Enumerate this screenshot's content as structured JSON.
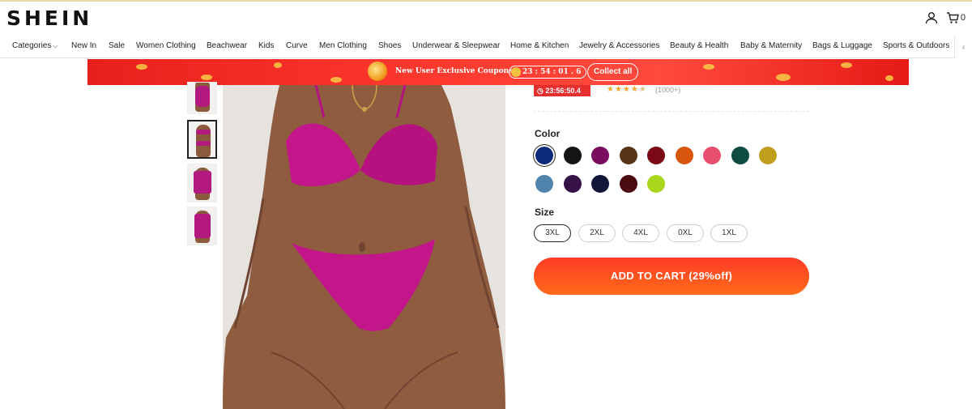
{
  "header": {
    "logo": "SHEIN",
    "cart_count": "0"
  },
  "nav": {
    "items": [
      "Categories",
      "New In",
      "Sale",
      "Women Clothing",
      "Beachwear",
      "Kids",
      "Curve",
      "Men Clothing",
      "Shoes",
      "Underwear & Sleepwear",
      "Home & Kitchen",
      "Jewelry & Accessories",
      "Beauty & Health",
      "Baby & Maternity",
      "Bags & Luggage",
      "Sports & Outdoors"
    ]
  },
  "banner": {
    "text": "New User Exclusive Coupons",
    "timer": "23 : 54 : 01 . 6",
    "button": "Collect all"
  },
  "product": {
    "flash_timer": "23:56:50.4",
    "rating_stars": 4.5,
    "review_count": "(1000+)",
    "color_label": "Color",
    "colors": [
      "#0b2a7a",
      "#151515",
      "#7a0d5e",
      "#5a3417",
      "#7a0b16",
      "#d9560f",
      "#e8506f",
      "#0d4b43",
      "#c2a01f",
      "#4e84ad",
      "#371246",
      "#12173a",
      "#4a0b10",
      "#a8d61c"
    ],
    "selected_color_index": 0,
    "size_label": "Size",
    "sizes": [
      "3XL",
      "2XL",
      "4XL",
      "0XL",
      "1XL"
    ],
    "selected_size_index": 0,
    "add_to_cart": "ADD TO CART  (29%off)"
  },
  "thumbnails": {
    "count": 4,
    "active_index": 1
  }
}
